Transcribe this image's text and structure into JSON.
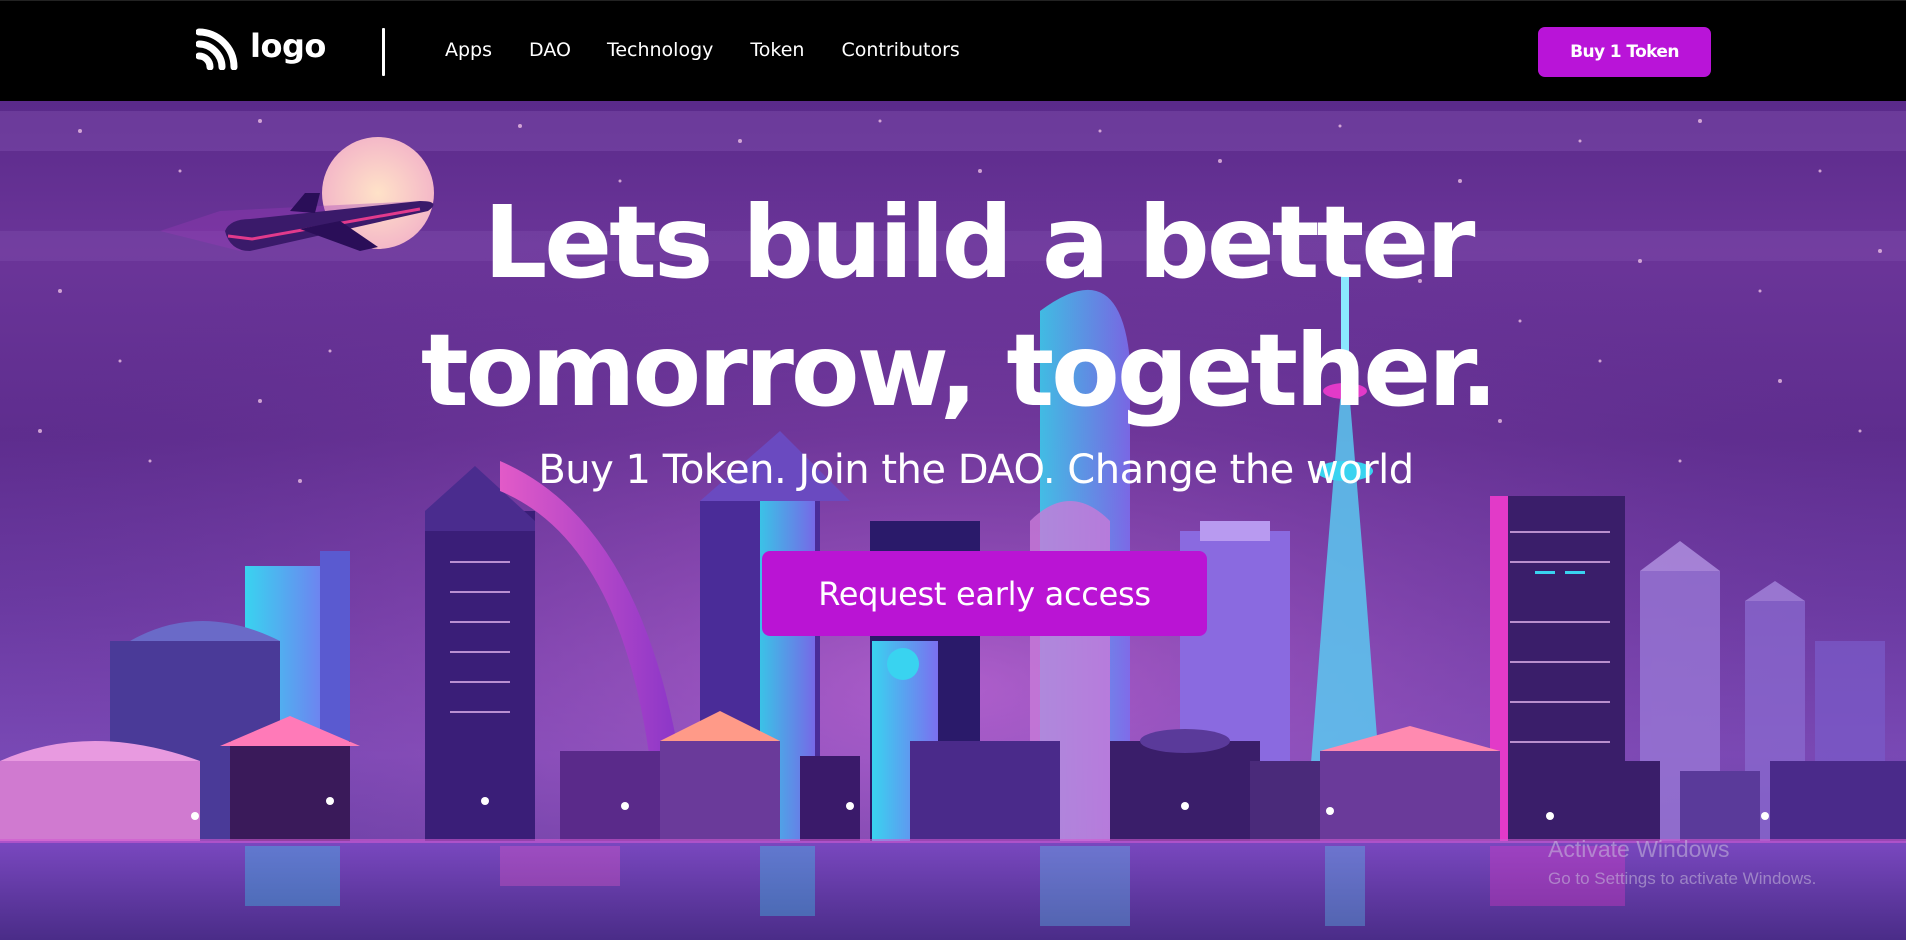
{
  "navbar": {
    "logo_text": "logo",
    "links": [
      "Apps",
      "DAO",
      "Technology",
      "Token",
      "Contributors"
    ],
    "buy_button_label": "Buy 1 Token"
  },
  "hero": {
    "title_line1": "Lets build a better",
    "title_line2": "tomorrow, together.",
    "subtitle": "Buy 1 Token. Join the DAO. Change the world",
    "cta_label": "Request early access",
    "illustration": "neon-city-skyline-with-airplane-and-moon"
  },
  "watermark": {
    "title": "Activate Windows",
    "subtitle": "Go to Settings to activate Windows."
  },
  "colors": {
    "accent": "#b914d8",
    "navbar_bg": "#000000",
    "hero_bg": "#5e2d8e"
  },
  "icons": {
    "logo": "rss-feed-icon"
  }
}
